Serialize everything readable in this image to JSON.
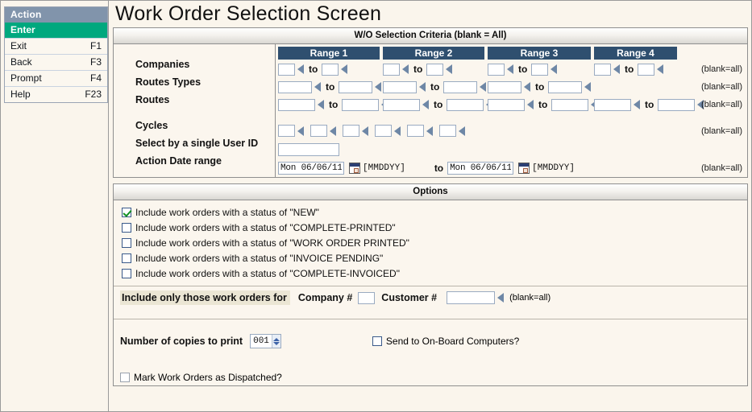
{
  "window": {
    "title": "Work Order Selection Screen"
  },
  "sidebar": {
    "header": "Action",
    "items": [
      {
        "label": "Enter",
        "key": "",
        "active": true
      },
      {
        "label": "Exit",
        "key": "F1",
        "active": false
      },
      {
        "label": "Back",
        "key": "F3",
        "active": false
      },
      {
        "label": "Prompt",
        "key": "F4",
        "active": false
      },
      {
        "label": "Help",
        "key": "F23",
        "active": false
      }
    ]
  },
  "criteria": {
    "header": "W/O Selection Criteria (blank = All)",
    "range_headers": [
      "Range 1",
      "Range 2",
      "Range 3",
      "Range 4"
    ],
    "to_label": "to",
    "blank_all": "(blank=all)",
    "rows": [
      {
        "label": "Companies",
        "values": [
          "",
          "",
          "",
          "",
          "",
          "",
          "",
          ""
        ]
      },
      {
        "label": "Routes Types",
        "values": [
          "",
          "",
          "",
          "",
          "",
          "",
          "",
          ""
        ]
      },
      {
        "label": "Routes",
        "values": [
          "",
          "",
          "",
          "",
          "",
          "",
          "",
          ""
        ]
      }
    ],
    "cycles": {
      "label": "Cycles",
      "values": [
        "",
        "",
        "",
        "",
        "",
        ""
      ]
    },
    "user_id": {
      "label": "Select by a single User ID",
      "value": ""
    },
    "action_date": {
      "label": "Action Date range",
      "from": "Mon 06/06/11",
      "to": "Mon 06/06/11",
      "format": "[MMDDYY]",
      "to_label": "to"
    }
  },
  "options": {
    "header": "Options",
    "statuses": [
      {
        "label": "Include work orders with a status of \"NEW\"",
        "checked": true
      },
      {
        "label": "Include work orders with a status of \"COMPLETE-PRINTED\"",
        "checked": false
      },
      {
        "label": "Include work orders with a status of \"WORK ORDER PRINTED\"",
        "checked": false
      },
      {
        "label": "Include work orders with a status of \"INVOICE PENDING\"",
        "checked": false
      },
      {
        "label": "Include work orders with a status of \"COMPLETE-INVOICED\"",
        "checked": false
      }
    ],
    "include_only": {
      "prefix": "Include only those work orders for",
      "company_label": "Company #",
      "company_value": "",
      "customer_label": "Customer #",
      "customer_value": "",
      "blank_all": "(blank=all)"
    },
    "copies": {
      "label": "Number of copies to print",
      "value": "001"
    },
    "onboard": {
      "label": "Send to On-Board Computers?",
      "checked": false
    },
    "dispatched": {
      "label": "Mark Work Orders as Dispatched?",
      "checked": false
    }
  },
  "colors": {
    "accent_header": "#2f4f6f",
    "menu_header": "#8194ab",
    "enter_green": "#00a87e",
    "page_bg": "#faf5ec"
  }
}
